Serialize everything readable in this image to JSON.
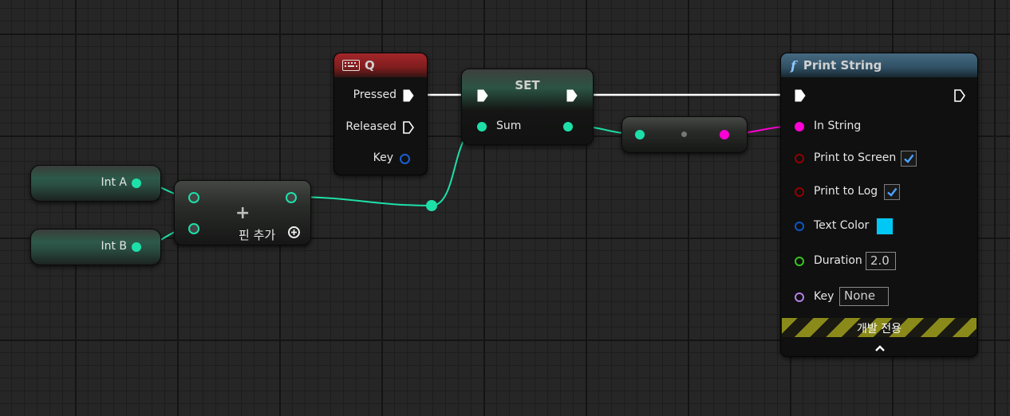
{
  "graph": {
    "key_event": {
      "title": "Q",
      "pins": {
        "pressed": "Pressed",
        "released": "Released",
        "key": "Key"
      }
    },
    "set_node": {
      "title": "SET",
      "pin": "Sum"
    },
    "var_int_a": {
      "label": "Int A"
    },
    "var_int_b": {
      "label": "Int B"
    },
    "add_node": {
      "symbol": "+",
      "add_pin_label": "핀 추가"
    },
    "print_string": {
      "title": "Print String",
      "function_symbol": "f",
      "pins": {
        "in_string": "In String",
        "print_to_screen": "Print to Screen",
        "print_to_log": "Print to Log",
        "text_color": "Text Color",
        "duration": "Duration",
        "key": "Key"
      },
      "values": {
        "duration": "2.0",
        "key": "None",
        "text_color": "#00c8f5",
        "print_to_screen": true,
        "print_to_log": true
      },
      "dev_only_label": "개발 전용",
      "expand_icon": "chevron-up-icon"
    }
  },
  "colors": {
    "exec": "#ffffff",
    "integer": "#1de0a8",
    "string": "#ff00d4",
    "bool": "#930000",
    "struct_color": "#0d55c8",
    "float": "#35c81a",
    "name": "#b680e8",
    "key_struct": "#1a5fd0"
  }
}
